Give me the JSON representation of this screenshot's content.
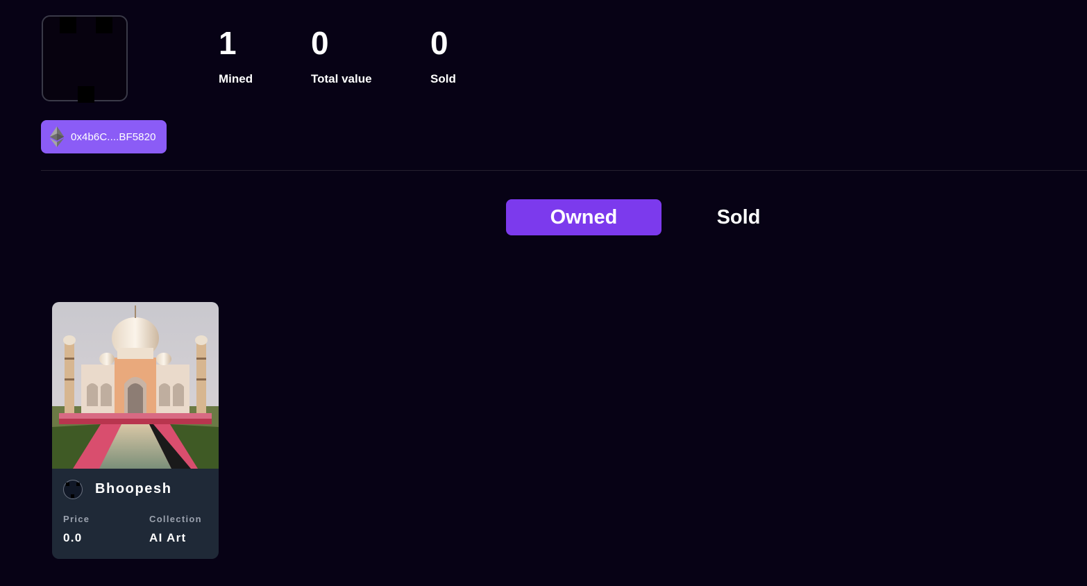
{
  "profile": {
    "wallet_address": "0x4b6C....BF5820",
    "wallet_icon": "ethereum-icon"
  },
  "stats": [
    {
      "value": "1",
      "label": "Mined"
    },
    {
      "value": "0",
      "label": "Total value"
    },
    {
      "value": "0",
      "label": "Sold"
    }
  ],
  "tabs": {
    "owned_label": "Owned",
    "sold_label": "Sold",
    "active": "Owned"
  },
  "nft_card": {
    "title": "Bhoopesh",
    "price_label": "Price",
    "price_value": "0.0",
    "collection_label": "Collection",
    "collection_value": "AI Art",
    "image_icon": "taj-mahal-image"
  },
  "colors": {
    "background": "#070215",
    "accent": "#7c3aed",
    "wallet_pill": "#8b5cf6",
    "card_body": "#1f2937"
  }
}
